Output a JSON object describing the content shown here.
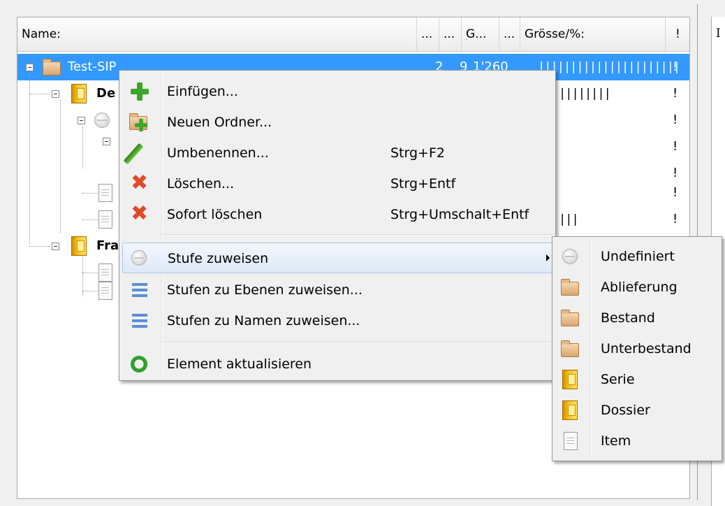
{
  "tree": {
    "columns": [
      "Name:",
      "...",
      "...",
      "G...",
      "...",
      "Grösse/%:",
      "!"
    ],
    "rows": [
      {
        "name": "Test-SIP",
        "c1": "2",
        "c2": "9",
        "c3": "1'260",
        "bars": "||||||||||||||||||||||",
        "flag": "!"
      },
      {
        "name": "De",
        "bars": "||||||||",
        "flag": "!"
      },
      {
        "flag": "!"
      },
      {
        "flag": "!"
      },
      {
        "flag": "!"
      },
      {
        "flag": "!"
      },
      {
        "bars": "|||",
        "flag": "!"
      },
      {
        "name": "Fra"
      }
    ]
  },
  "context_menu": {
    "items": [
      {
        "label": "Einfügen...",
        "shortcut": "",
        "icon": "add-icon"
      },
      {
        "label": "Neuen Ordner...",
        "shortcut": "",
        "icon": "new-folder-icon"
      },
      {
        "label": "Umbenennen...",
        "shortcut": "Strg+F2",
        "icon": "pencil-icon"
      },
      {
        "label": "Löschen...",
        "shortcut": "Strg+Entf",
        "icon": "delete-icon"
      },
      {
        "label": "Sofort löschen",
        "shortcut": "Strg+Umschalt+Entf",
        "icon": "delete-icon"
      },
      {
        "label": "Stufe zuweisen",
        "shortcut": "",
        "icon": "level-circle-icon"
      },
      {
        "label": "Stufen zu Ebenen zuweisen...",
        "shortcut": "",
        "icon": "list-icon"
      },
      {
        "label": "Stufen zu Namen zuweisen...",
        "shortcut": "",
        "icon": "list-icon"
      },
      {
        "label": "Element aktualisieren",
        "shortcut": "",
        "icon": "refresh-icon"
      }
    ]
  },
  "submenu": {
    "items": [
      {
        "label": "Undefiniert",
        "icon": "level-circle-icon"
      },
      {
        "label": "Ablieferung",
        "icon": "folder-icon"
      },
      {
        "label": "Bestand",
        "icon": "folder-icon"
      },
      {
        "label": "Unterbestand",
        "icon": "folder-icon"
      },
      {
        "label": "Serie",
        "icon": "binder-icon"
      },
      {
        "label": "Dossier",
        "icon": "binder-icon"
      },
      {
        "label": "Item",
        "icon": "document-icon"
      }
    ]
  },
  "colors": {
    "selection": "#3399ff",
    "menu_bg": "#f0f0f0",
    "highlight_border": "#a9c4e8"
  }
}
